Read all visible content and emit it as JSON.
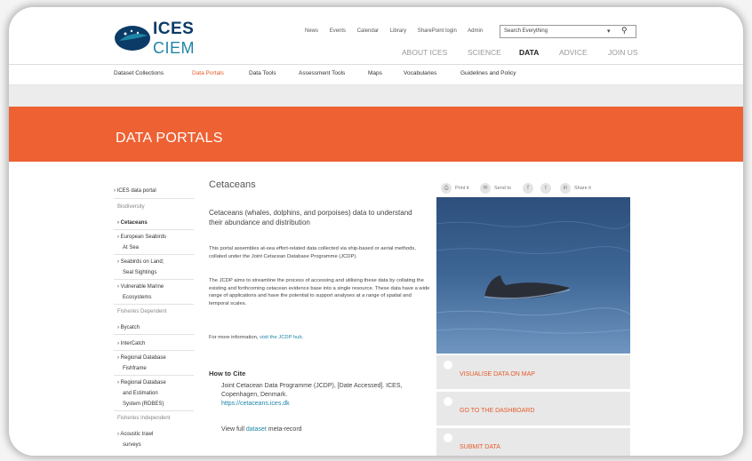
{
  "header": {
    "logo_top": "ICES",
    "logo_bottom": "CIEM",
    "utility_links": [
      "News",
      "Events",
      "Calendar",
      "Library",
      "SharePoint login",
      "Admin"
    ],
    "search_placeholder": "Search Everything",
    "main_nav": [
      {
        "label": "ABOUT ICES",
        "active": false
      },
      {
        "label": "SCIENCE",
        "active": false
      },
      {
        "label": "DATA",
        "active": true
      },
      {
        "label": "ADVICE",
        "active": false
      },
      {
        "label": "JOIN US",
        "active": false
      }
    ]
  },
  "subnav": [
    "Dataset Collections",
    "Data Portals",
    "Data Tools",
    "Assessment Tools",
    "Maps",
    "Vocabularies",
    "Guidelines and Policy"
  ],
  "banner_title": "DATA PORTALS",
  "leftnav": [
    "› ICES data portal",
    "Biodiversity",
    "› Cetaceans",
    "› European Seabirds",
    "At Sea",
    "› Seabirds on Land;",
    "Seal Sightings",
    "› Vulnerable Marine",
    "Ecosystems",
    "Fisheries Dependent",
    "› Bycatch",
    "› InterCatch",
    "› Regional Database",
    "Fishframe",
    "› Regional Database",
    "and Estimation",
    "System (RDBES)",
    "Fisheries Independent",
    "› Acoustic trawl",
    "surveys"
  ],
  "content": {
    "title": "Cetaceans",
    "lead": "Cetaceans (whales, dolphins, and porpoises) data to understand their abundance and distribution",
    "p1": "This portal assembles at-sea effort-related data collected via ship-based or aerial methods, collated under the Joint Cetacean Database Programme (JCDP).",
    "p2": "The JCDP aims to streamline the process of accessing and utilising these data by collating the existing and forthcoming cetacean evidence base into a single resource. These data have a wide range of applications and have the potential to support analyses at a range of spatial and temporal scales.",
    "p3_prefix": "For more information, ",
    "p3_link": "visit the JCDP hub.",
    "cite_heading": "How to Cite",
    "cite_text": "Joint Cetacean Data Programme (JCDP), [Date Accessed]. ICES, Copenhagen, Denmark.",
    "cite_link": "https://cetaceans.ices.dk",
    "meta_prefix": "View full ",
    "meta_link": "dataset",
    "meta_suffix": " meta-record"
  },
  "share": {
    "print": "Print it",
    "send": "Send to",
    "facebook": "f",
    "twitter": "t",
    "linkedin": "in",
    "share": "Share it"
  },
  "actions": [
    "VISUALISE DATA ON MAP",
    "GO TO THE DASHBOARD",
    "SUBMIT DATA"
  ],
  "colors": {
    "accent": "#ee6133",
    "navy": "#0b3b66",
    "teal": "#1f86a8"
  }
}
